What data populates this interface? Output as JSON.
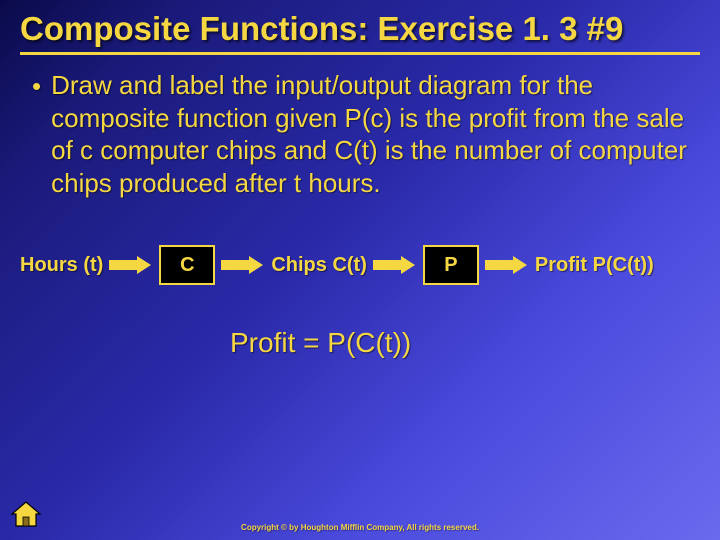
{
  "title": "Composite Functions: Exercise 1. 3 #9",
  "bullet_text": "Draw and label the input/output diagram for the composite function given P(c) is the profit from the sale of c computer chips and C(t) is the number of computer chips produced after t hours.",
  "diagram": {
    "input": "Hours (t)",
    "box1": "C",
    "mid": "Chips C(t)",
    "box2": "P",
    "output": "Profit P(C(t))"
  },
  "equation": "Profit = P(C(t))",
  "copyright": "Copyright © by Houghton Mifflin Company, All rights reserved."
}
